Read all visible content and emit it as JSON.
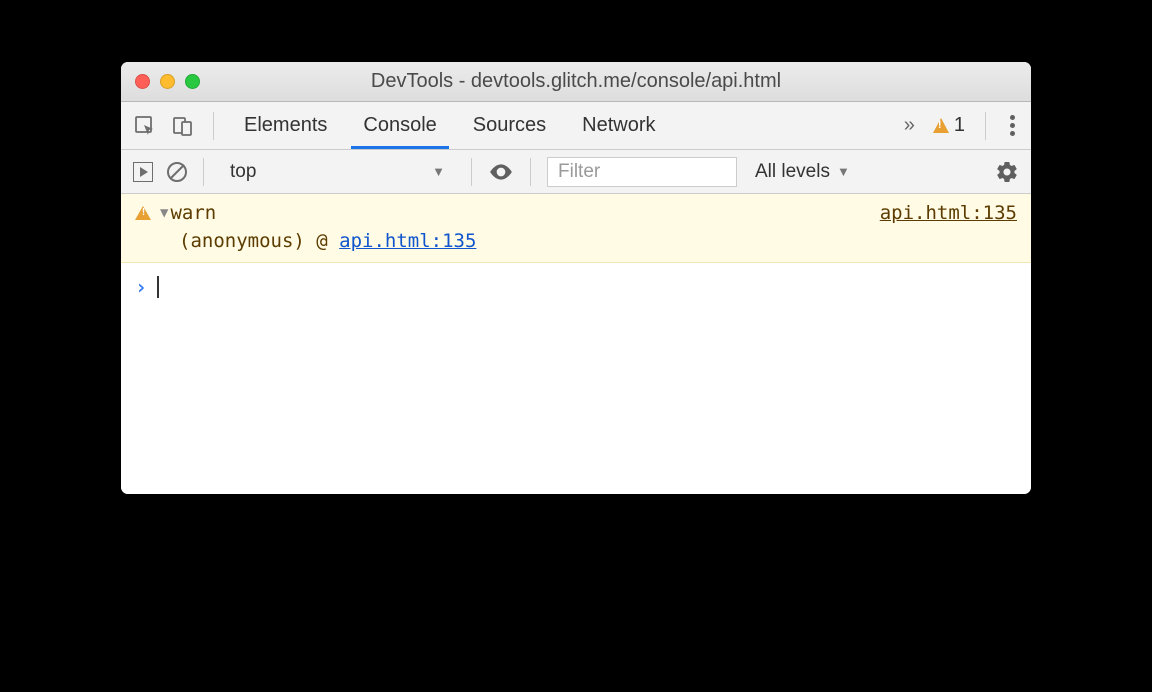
{
  "window": {
    "title": "DevTools - devtools.glitch.me/console/api.html"
  },
  "tabs": {
    "items": [
      "Elements",
      "Console",
      "Sources",
      "Network"
    ],
    "active_index": 1,
    "warning_count": "1"
  },
  "toolbar": {
    "context": "top",
    "filter_placeholder": "Filter",
    "levels": "All levels"
  },
  "log": {
    "message": "warn",
    "source": "api.html:135",
    "stack_label": "(anonymous) @ ",
    "stack_link": "api.html:135"
  }
}
